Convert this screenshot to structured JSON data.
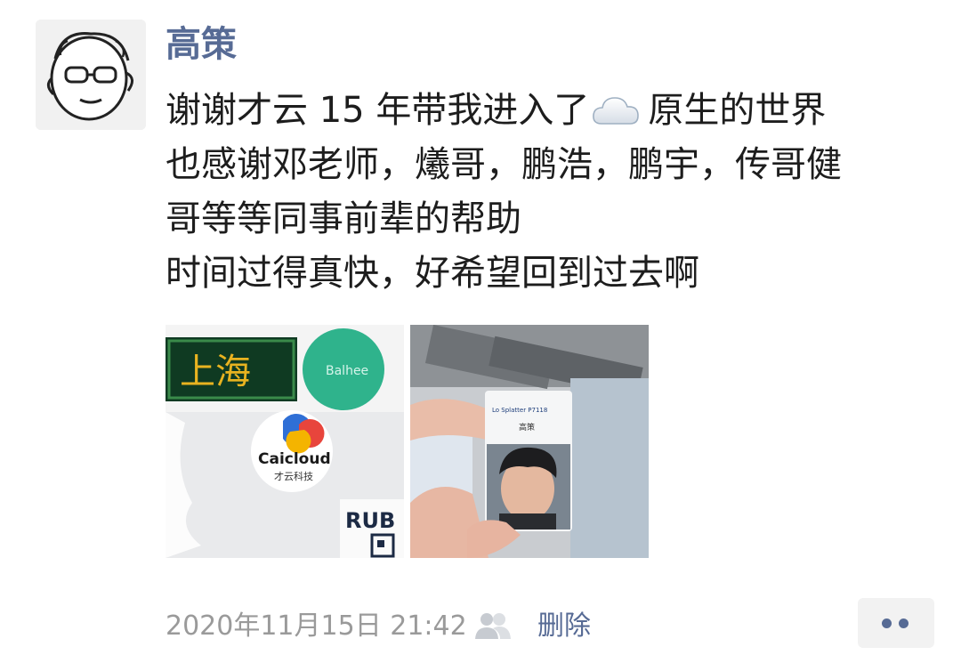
{
  "author": {
    "name": "高策"
  },
  "post": {
    "line1_before_icon": "谢谢才云 15 年带我进入了",
    "line1_after_icon": "原生的世界",
    "line2": "也感谢邓老师，爔哥，鹏浩，鹏宇，传哥健",
    "line3": "哥等等同事前辈的帮助",
    "line4": "时间过得真快，好希望回到过去啊",
    "inline_icon": "cloud-icon"
  },
  "photos": [
    {
      "sign_text": "上海",
      "logo_text": "Caicloud",
      "logo_subtext": "才云科技",
      "laptop_text": "RUB",
      "circle_text": "Balhee"
    },
    {
      "card_header": "Lo Splatter P7118",
      "card_name": "高策"
    }
  ],
  "footer": {
    "timestamp": "2020年11月15日 21:42",
    "visibility_icon": "friends-icon",
    "delete_label": "删除",
    "more_icon": "more-dots-icon"
  },
  "colors": {
    "link": "#576b95",
    "text": "#1d1d1d",
    "meta": "#9a9a9a"
  }
}
